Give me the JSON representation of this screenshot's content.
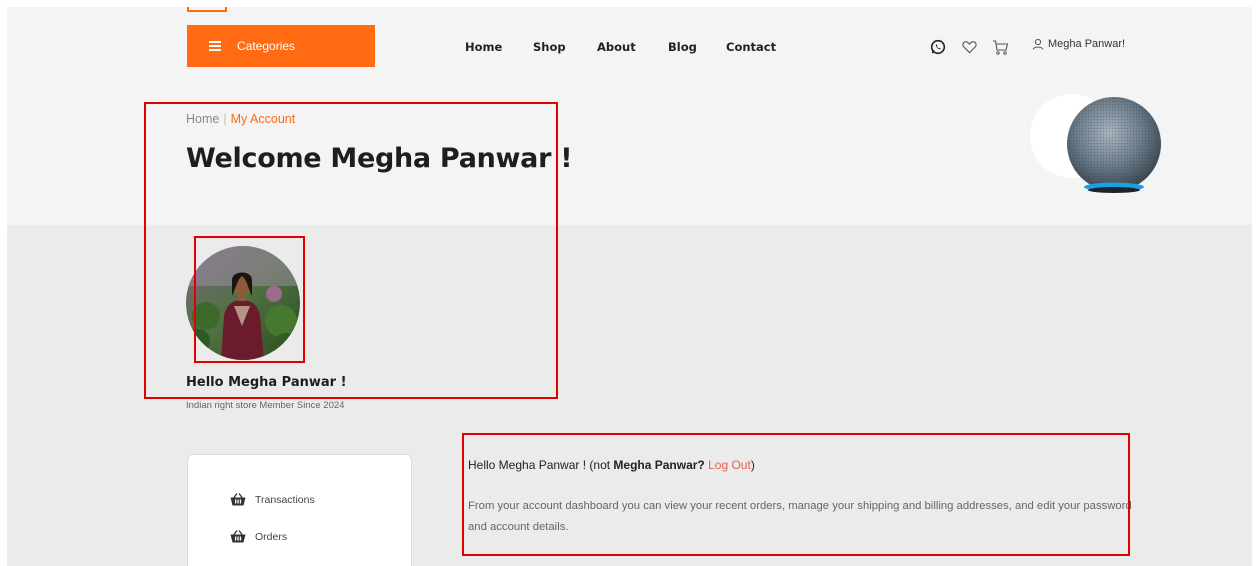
{
  "header": {
    "categories_label": "Categories",
    "nav": [
      "Home",
      "Shop",
      "About",
      "Blog",
      "Contact"
    ],
    "icons": [
      "whatsapp-icon",
      "heart-icon",
      "cart-icon",
      "user-icon"
    ],
    "user_label": "Megha Panwar!"
  },
  "hero": {
    "breadcrumb_home": "Home",
    "breadcrumb_sep": "|",
    "breadcrumb_current": "My Account",
    "title": "Welcome Megha Panwar !"
  },
  "profile": {
    "hello": "Hello Megha Panwar !",
    "member_since": "Indian right store Member Since 2024"
  },
  "sidebar": {
    "items": [
      {
        "label": "Transactions",
        "icon": "basket-icon"
      },
      {
        "label": "Orders",
        "icon": "basket-icon"
      }
    ]
  },
  "dashboard": {
    "hello_prefix": "Hello Megha Panwar ! (not ",
    "hello_name": "Megha Panwar?",
    "logout": "Log Out",
    "hello_suffix": ")",
    "description": "From your account dashboard you can view your recent orders, manage your shipping and billing addresses, and edit your password and account details."
  },
  "colors": {
    "accent": "#ff6a13",
    "highlight": "#e00000",
    "logout": "#e8604c"
  }
}
